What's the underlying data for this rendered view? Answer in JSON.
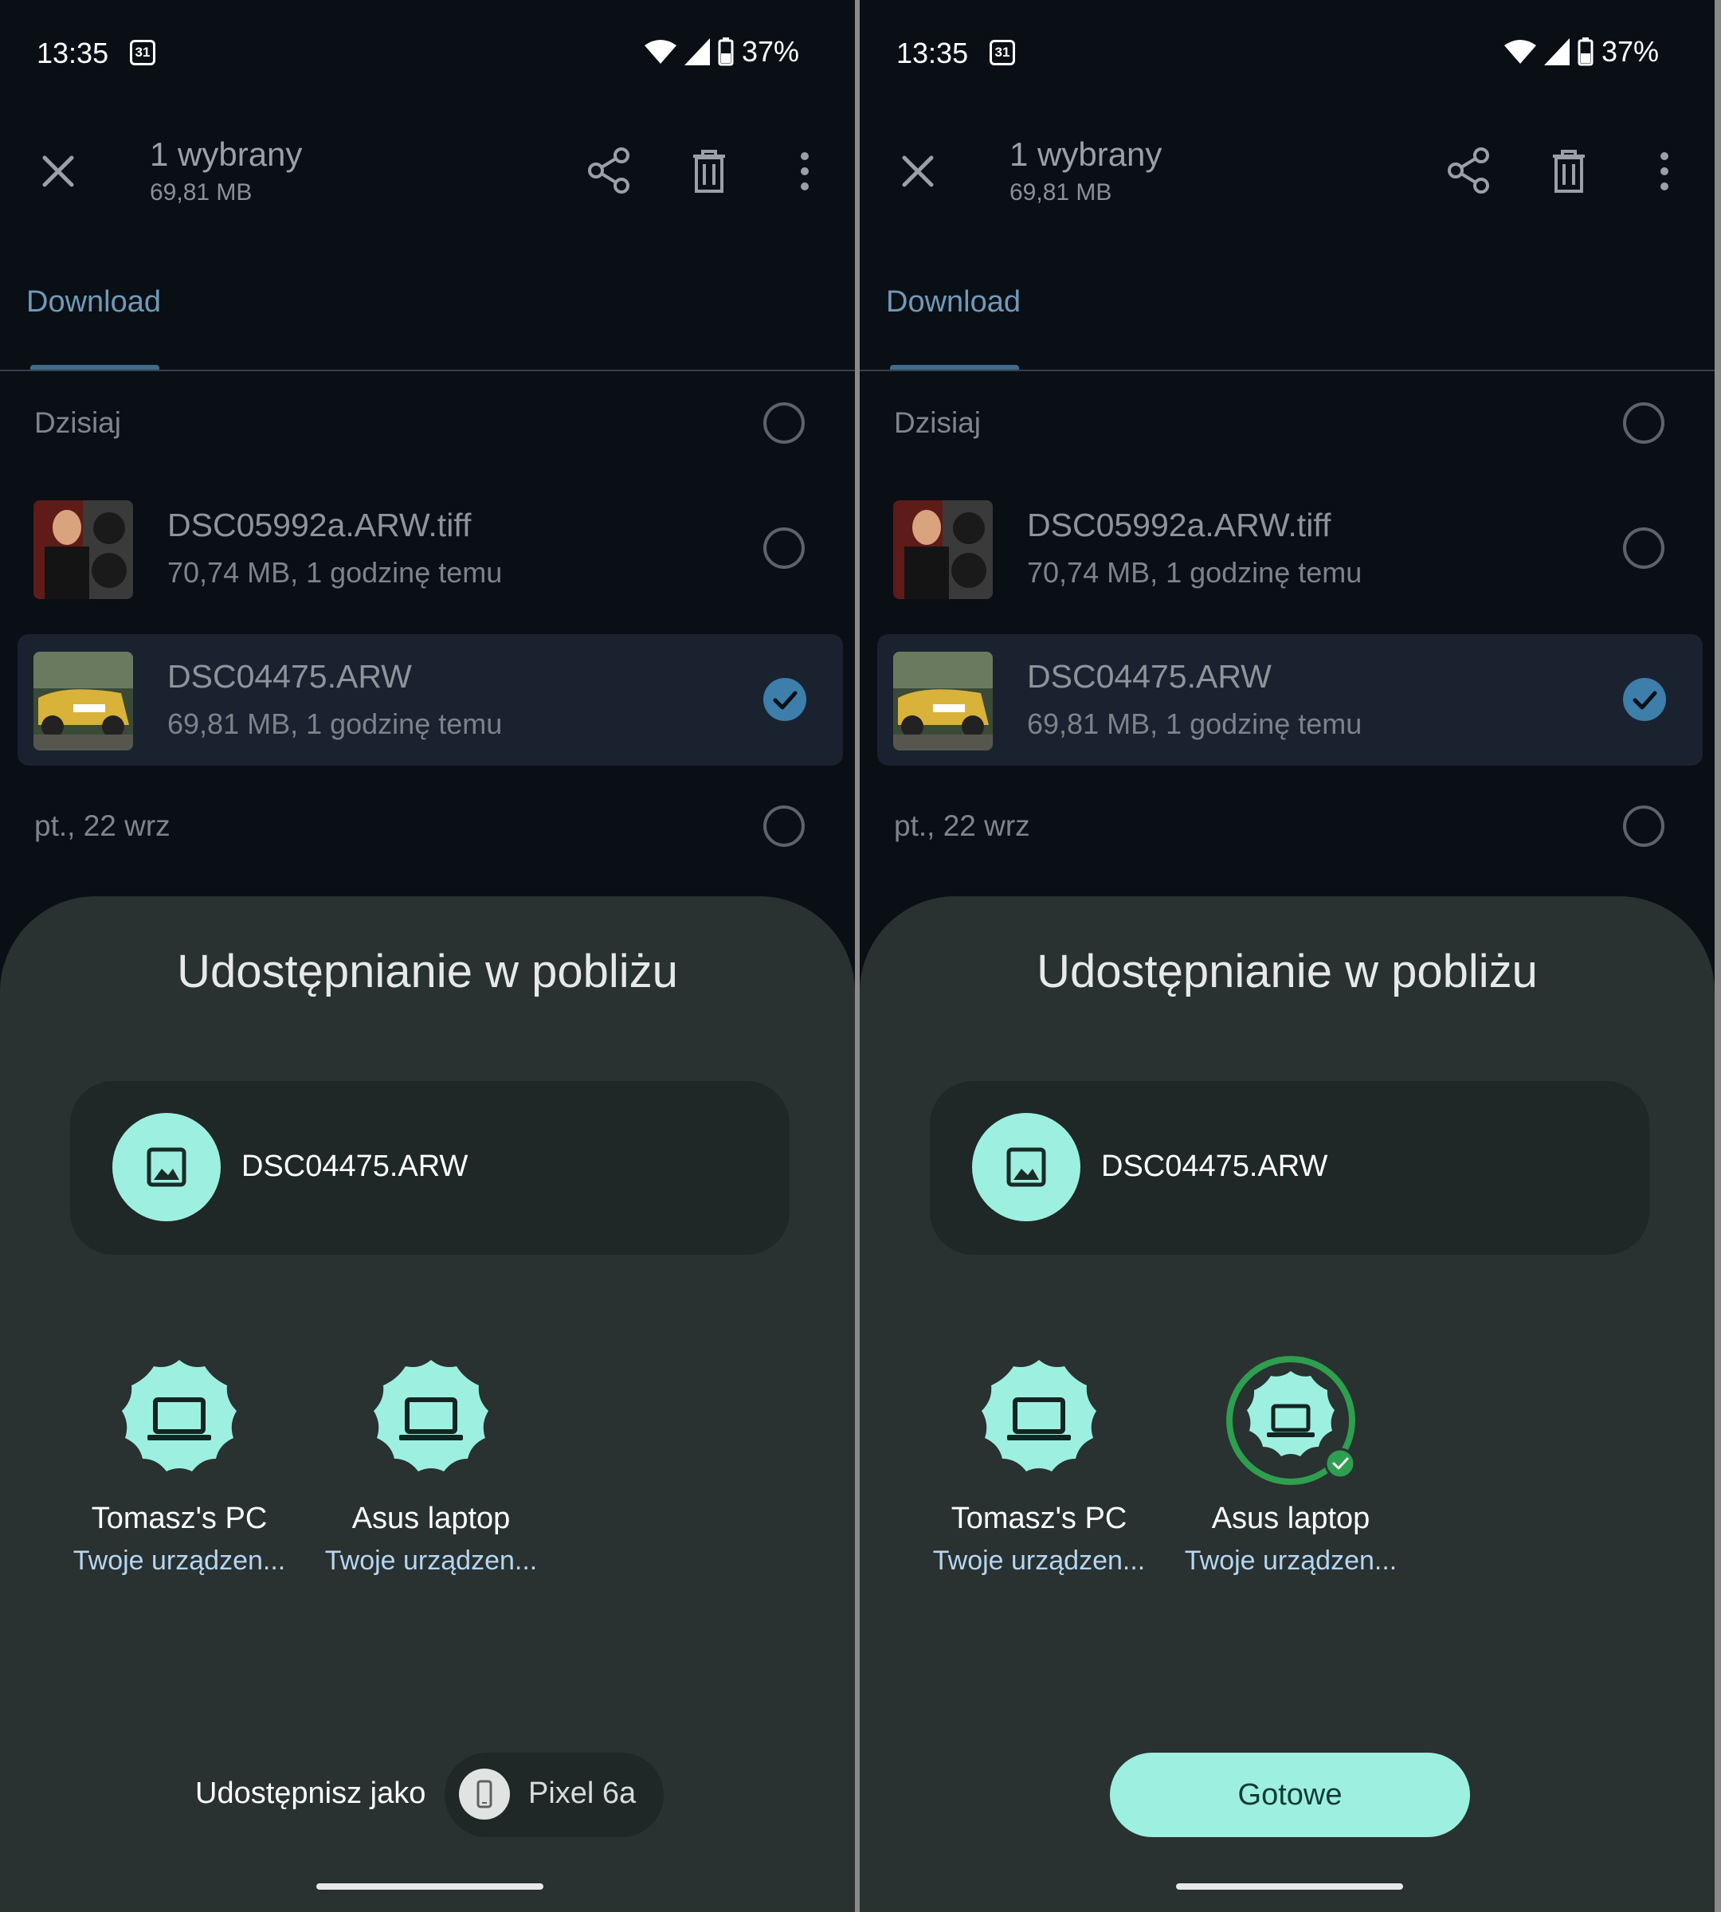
{
  "screens": [
    {
      "status_bar": {
        "time": "13:35",
        "calendar_day": "31",
        "battery": "37%"
      },
      "toolbar": {
        "title": "1 wybrany",
        "subtitle": "69,81 MB"
      },
      "tab": {
        "label": "Download"
      },
      "sections": {
        "today": "Dzisiaj",
        "older": "pt., 22 wrz"
      },
      "files": [
        {
          "name": "DSC05992a.ARW.tiff",
          "meta": "70,74 MB, 1 godzinę temu",
          "selected": false
        },
        {
          "name": "DSC04475.ARW",
          "meta": "69,81 MB, 1 godzinę temu",
          "selected": true
        }
      ],
      "sheet": {
        "title": "Udostępnianie w pobliżu",
        "file_name": "DSC04475.ARW",
        "devices": [
          {
            "name": "Tomasz's PC",
            "sub": "Twoje urządzen...",
            "selected": false
          },
          {
            "name": "Asus laptop",
            "sub": "Twoje urządzen...",
            "selected": false
          }
        ],
        "share_as_label": "Udostępnisz jako",
        "share_as_device": "Pixel 6a"
      }
    },
    {
      "status_bar": {
        "time": "13:35",
        "calendar_day": "31",
        "battery": "37%"
      },
      "toolbar": {
        "title": "1 wybrany",
        "subtitle": "69,81 MB"
      },
      "tab": {
        "label": "Download"
      },
      "sections": {
        "today": "Dzisiaj",
        "older": "pt., 22 wrz"
      },
      "files": [
        {
          "name": "DSC05992a.ARW.tiff",
          "meta": "70,74 MB, 1 godzinę temu",
          "selected": false
        },
        {
          "name": "DSC04475.ARW",
          "meta": "69,81 MB, 1 godzinę temu",
          "selected": true
        }
      ],
      "sheet": {
        "title": "Udostępnianie w pobliżu",
        "file_name": "DSC04475.ARW",
        "devices": [
          {
            "name": "Tomasz's PC",
            "sub": "Twoje urządzen...",
            "selected": false
          },
          {
            "name": "Asus laptop",
            "sub": "Twoje urządzen...",
            "selected": true
          }
        ],
        "done_label": "Gotowe"
      }
    }
  ],
  "colors": {
    "accent": "#9df0e0",
    "selected_check": "#3d7eaa",
    "success": "#2e9e4f",
    "link_blue": "#6f9ab8"
  }
}
